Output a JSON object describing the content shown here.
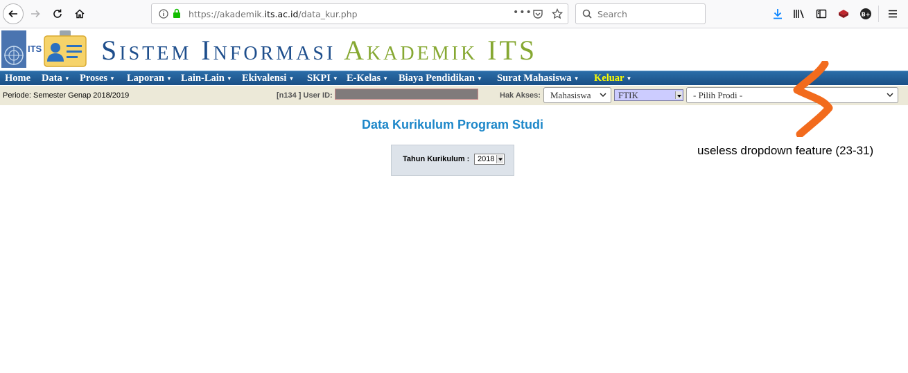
{
  "browser": {
    "url_prefix": "https://akademik.",
    "url_domain": "its.ac.id",
    "url_path": "/data_kur.php",
    "search_placeholder": "Search"
  },
  "header": {
    "logo_text": "ITS",
    "title_part1": "Sistem Informasi",
    "title_part2": "Akademik ITS"
  },
  "menu": {
    "items": [
      {
        "label": "Home",
        "has_caret": false
      },
      {
        "label": "Data",
        "has_caret": true
      },
      {
        "label": "Proses",
        "has_caret": true
      },
      {
        "label": "Laporan",
        "has_caret": true
      },
      {
        "label": "Lain-Lain",
        "has_caret": true
      },
      {
        "label": "Ekivalensi",
        "has_caret": true
      },
      {
        "label": "SKPI",
        "has_caret": true
      },
      {
        "label": "E-Kelas",
        "has_caret": true
      },
      {
        "label": "Biaya Pendidikan",
        "has_caret": true
      },
      {
        "label": "Surat Mahasiswa",
        "has_caret": true
      },
      {
        "label": "Keluar",
        "has_caret": true,
        "color": "#ffff00"
      }
    ]
  },
  "infobar": {
    "periode": "Periode: Semester Genap 2018/2019",
    "user_id_label": "[n134 ] User ID:",
    "hak_akses_label": "Hak Akses:",
    "role_value": "Mahasiswa",
    "fakultas_value": "FTIK",
    "prodi_value": "- Pilih Prodi -"
  },
  "main": {
    "heading": "Data Kurikulum Program Studi",
    "tahun_label": "Tahun Kurikulum :",
    "tahun_value": "2018"
  },
  "annotation": {
    "text": "useless dropdown feature (23-31)",
    "color": "#f26b1d"
  },
  "colors": {
    "menu_bg": "#1a4f85",
    "heading": "#1d87c9",
    "title_blue": "#1e4e8c",
    "title_green": "#86a832",
    "infobar_bg": "#ece9d8"
  }
}
